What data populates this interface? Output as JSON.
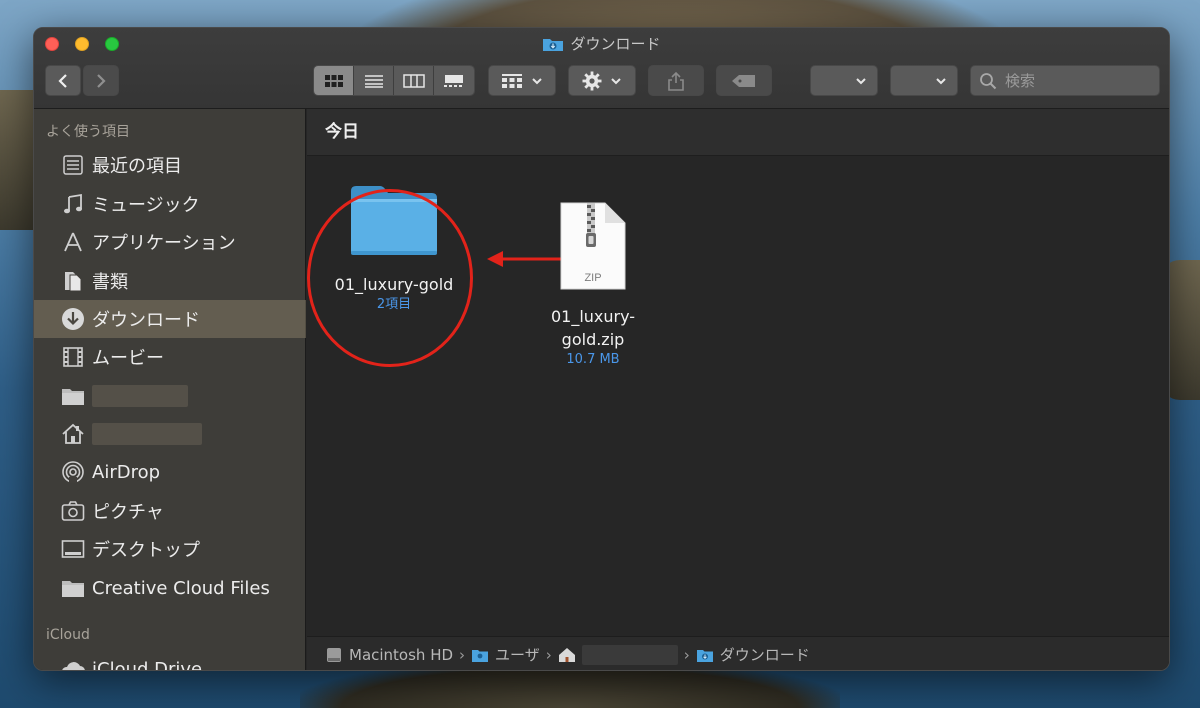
{
  "window": {
    "title": "ダウンロード"
  },
  "toolbar": {
    "search_placeholder": "検索"
  },
  "sidebar": {
    "favorites_header": "よく使う項目",
    "items": [
      {
        "label": "最近の項目",
        "icon": "recents-icon"
      },
      {
        "label": "ミュージック",
        "icon": "music-icon"
      },
      {
        "label": "アプリケーション",
        "icon": "applications-icon"
      },
      {
        "label": "書類",
        "icon": "documents-icon"
      },
      {
        "label": "ダウンロード",
        "icon": "downloads-icon",
        "selected": true
      },
      {
        "label": "ムービー",
        "icon": "movies-icon"
      },
      {
        "label": "",
        "icon": "folder-icon",
        "redacted": true
      },
      {
        "label": "",
        "icon": "home-icon",
        "redacted": true
      },
      {
        "label": "AirDrop",
        "icon": "airdrop-icon"
      },
      {
        "label": "ピクチャ",
        "icon": "pictures-icon"
      },
      {
        "label": "デスクトップ",
        "icon": "desktop-icon"
      },
      {
        "label": "Creative Cloud Files",
        "icon": "folder-icon"
      }
    ],
    "icloud_header": "iCloud",
    "icloud_items": [
      {
        "label": "iCloud Drive",
        "icon": "cloud-icon"
      }
    ]
  },
  "content": {
    "group_header": "今日",
    "files": [
      {
        "name": "01_luxury-gold",
        "meta": "2項目",
        "kind": "folder"
      },
      {
        "name_line1": "01_luxury-",
        "name_line2": "gold.zip",
        "meta": "10.7 MB",
        "kind": "zip",
        "badge": "ZIP"
      }
    ]
  },
  "pathbar": {
    "items": [
      "Macintosh HD",
      "ユーザ",
      "",
      "ダウンロード"
    ]
  },
  "colors": {
    "annotation": "#e2231a",
    "meta_blue": "#4a97ea",
    "folder_blue": "#5ab0e6"
  }
}
